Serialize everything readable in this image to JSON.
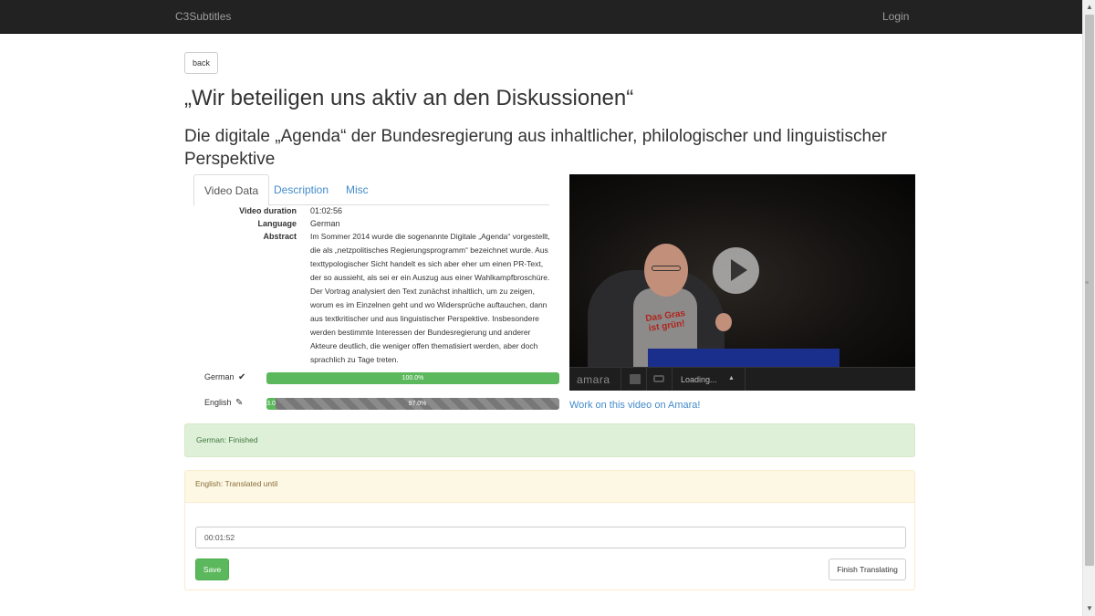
{
  "navbar": {
    "brand": "C3Subtitles",
    "login": "Login"
  },
  "back_label": "back",
  "title": "„Wir beteiligen uns aktiv an den Diskussionen“",
  "subtitle": "Die digitale „Agenda“ der Bundesregierung aus inhaltlicher, philologischer und linguistischer Perspektive",
  "tabs": [
    {
      "label": "Video Data",
      "active": true
    },
    {
      "label": "Description",
      "active": false
    },
    {
      "label": "Misc",
      "active": false
    }
  ],
  "video_data": {
    "duration_label": "Video duration",
    "duration": "01:02:56",
    "language_label": "Language",
    "language": "German",
    "abstract_label": "Abstract",
    "abstract": "Im Sommer 2014 wurde die sogenannte Digitale „Agenda“ vorgestellt, die als „netzpolitisches Regierungsprogramm“ bezeichnet wurde. Aus texttypologischer Sicht handelt es sich aber eher um einen PR-Text, der so aussieht, als sei er ein Auszug aus einer Wahlkampfbroschüre. Der Vortrag analysiert den Text zunächst inhaltlich, um zu zeigen, worum es im Einzelnen geht und wo Widersprüche auftauchen, dann aus textkritischer und aus linguistischer Perspektive. Insbesondere werden bestimmte Interessen der Bundesregierung und anderer Akteure deutlich, die weniger offen thematisiert werden, aber doch sprachlich zu Tage treten."
  },
  "progress": [
    {
      "language": "German",
      "icon": "checkmark-icon",
      "glyph": "✔",
      "done_label": "100.0%",
      "done_fraction": 1.0,
      "remaining_label": ""
    },
    {
      "language": "English",
      "icon": "pencil-icon",
      "glyph": "✎",
      "done_label": "3.0",
      "done_fraction": 0.03,
      "remaining_label": "97.0%"
    }
  ],
  "video_player": {
    "shirt_text": "Das Gras ist grün!",
    "logo": "amara",
    "loading": "Loading...",
    "caret": "▲"
  },
  "amara_link": "Work on this video on Amara!",
  "alert_finished": "German: Finished",
  "translation_panel": {
    "heading": "English: Translated until",
    "time_value": "00:01:52",
    "save_label": "Save",
    "finish_label": "Finish Translating"
  },
  "colors": {
    "navbar": "#222222",
    "link": "#428bca",
    "success": "#5cb85c",
    "progress_remaining": "#777777",
    "alert_success_bg": "#dff0d8",
    "panel_warning_bg": "#fcf8e3"
  }
}
